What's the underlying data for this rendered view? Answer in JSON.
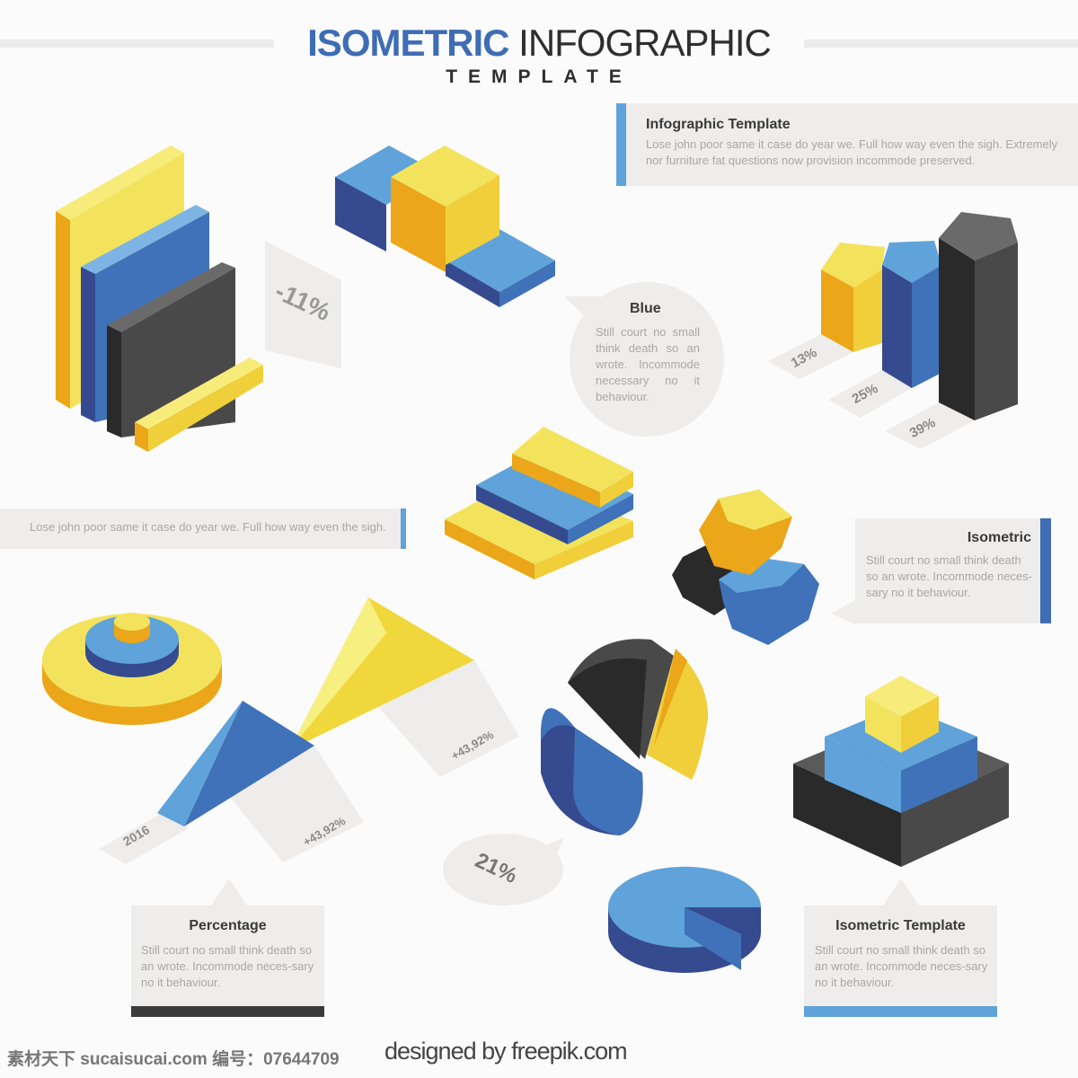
{
  "header": {
    "title_bold": "ISOMETRIC",
    "title_light": "INFOGRAPHIC",
    "subtitle": "TEMPLATE"
  },
  "colors": {
    "blue": "#3f6db5",
    "light_blue": "#5fa3da",
    "dark_blue": "#354a8f",
    "yellow": "#f3e35c",
    "orange": "#eba619",
    "dark": "#3b3a3a",
    "panel": "#eeedec"
  },
  "top_box": {
    "title": "Infographic Template",
    "text": "Lose john poor same it case do year we. Full how way even the sigh. Extremely nor furniture fat questions now provision incommode preserved."
  },
  "left_strip": {
    "text": "Lose john poor same it case do year we. Full how way even the sigh."
  },
  "minus_label": "-11%",
  "blue_bubble": {
    "title": "Blue",
    "text": "Still court no small think death so an wrote. Incommode necessary no it behaviour."
  },
  "bar_labels": [
    "13%",
    "25%",
    "39%"
  ],
  "isometric_box": {
    "title": "Isometric",
    "text": "Still court no small think death so an wrote. Incommode neces-sary no it behaviour."
  },
  "triangle_labels": {
    "year": "2016",
    "upper": "+43,92%",
    "lower": "+43,92%"
  },
  "pie_bubble": "21%",
  "percentage_box": {
    "title": "Percentage",
    "text": "Still court no small think death so an wrote. Incommode neces-sary no it behaviour."
  },
  "template_box": {
    "title": "Isometric Template",
    "text": "Still court no small think death so an wrote. Incommode neces-sary no it behaviour."
  },
  "footer": {
    "watermark": "素材天下 sucaisucai.com  编号：07644709",
    "credit": "designed by freepik.com"
  }
}
